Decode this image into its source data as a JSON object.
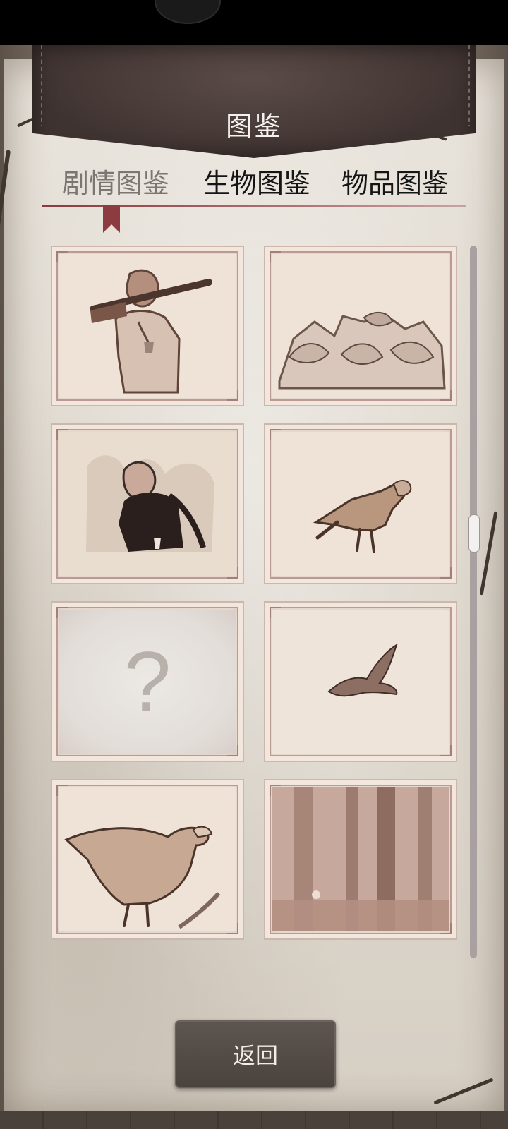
{
  "header": {
    "title": "图鉴"
  },
  "tabs": [
    {
      "label": "剧情图鉴",
      "active": true
    },
    {
      "label": "生物图鉴",
      "active": false
    },
    {
      "label": "物品图鉴",
      "active": false
    }
  ],
  "cards": [
    {
      "name": "soldier-with-rifle",
      "unlocked": true
    },
    {
      "name": "rock-pile",
      "unlocked": true
    },
    {
      "name": "vulture-on-nest",
      "unlocked": true
    },
    {
      "name": "hawk-standing",
      "unlocked": true
    },
    {
      "name": "locked-card",
      "unlocked": false,
      "label": "?"
    },
    {
      "name": "bird-flying",
      "unlocked": true
    },
    {
      "name": "eagle-perched",
      "unlocked": true
    },
    {
      "name": "forest-scene",
      "unlocked": true
    }
  ],
  "footer": {
    "back_label": "返回"
  },
  "colors": {
    "banner": "#3f3331",
    "accent": "#8d3b40",
    "paper": "#e9e4dc",
    "button": "#4a433e"
  }
}
